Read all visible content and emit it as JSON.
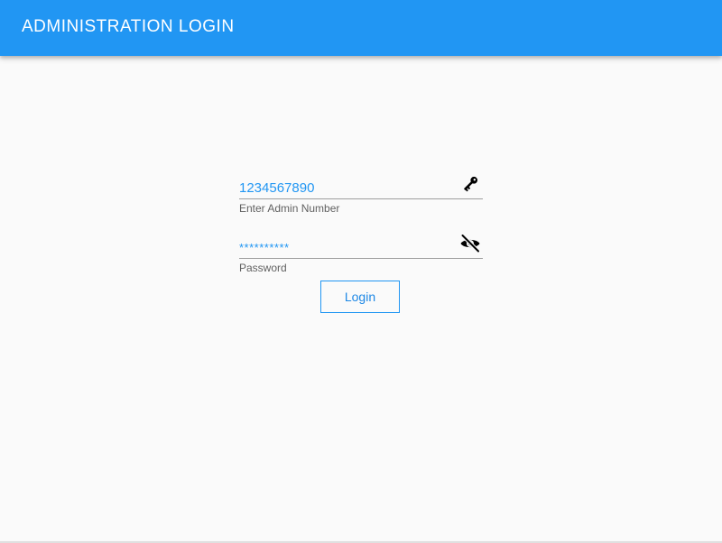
{
  "app_bar": {
    "title": "ADMINISTRATION LOGIN",
    "color": "#2196f3"
  },
  "form": {
    "admin_number": {
      "value": "1234567890",
      "label": "Enter Admin Number",
      "icon": "key-icon"
    },
    "password": {
      "value": "**********",
      "label": "Password",
      "icon": "visibility-off-icon"
    },
    "login_button_label": "Login"
  },
  "colors": {
    "accent": "#2196f3",
    "background": "#fafafa",
    "label_text": "#616161",
    "underline": "#9e9e9e"
  }
}
